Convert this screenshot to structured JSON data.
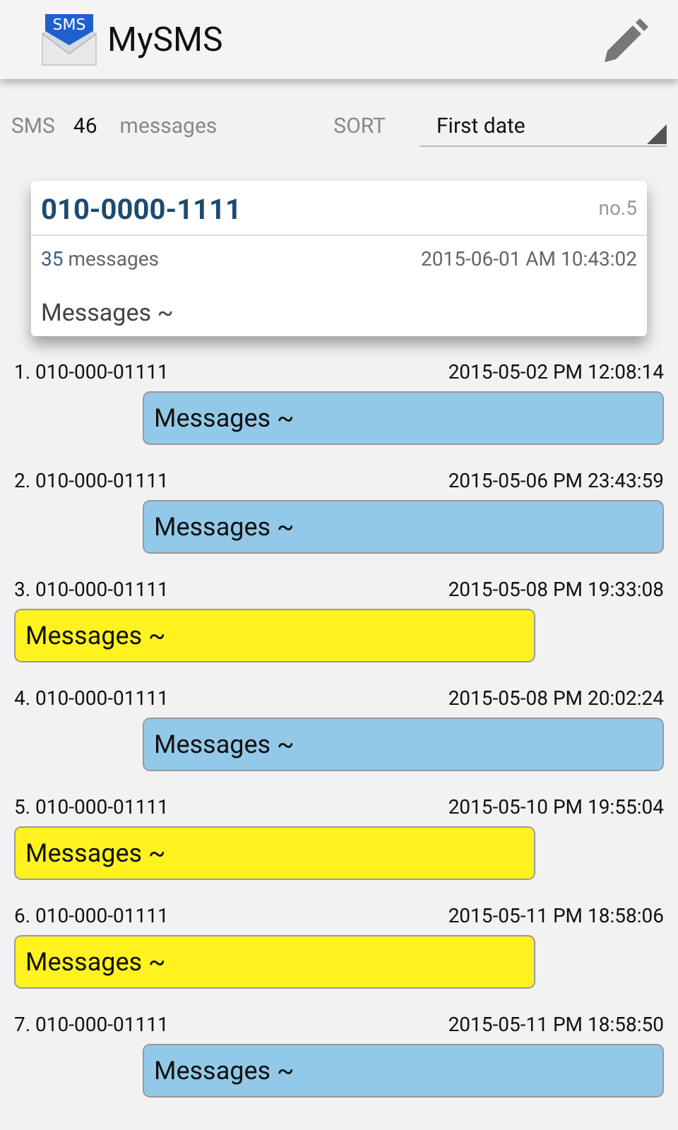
{
  "app_bar": {
    "logo_text": "SMS",
    "title": "MySMS"
  },
  "summary": {
    "label": "SMS",
    "count": "46",
    "unit": "messages",
    "sort_label": "SORT",
    "sort_value": "First date"
  },
  "contact_card": {
    "number": "010-0000-1111",
    "index": "no.5",
    "message_count": "35",
    "message_unit": "messages",
    "date": "2015-06-01 AM 10:43:02",
    "preview": "Messages ~"
  },
  "messages": [
    {
      "title": "1. 010-000-01111",
      "date": "2015-05-02 PM 12:08:14",
      "text": "Messages ~",
      "kind": "incoming"
    },
    {
      "title": "2. 010-000-01111",
      "date": "2015-05-06 PM 23:43:59",
      "text": "Messages ~",
      "kind": "incoming"
    },
    {
      "title": "3. 010-000-01111",
      "date": "2015-05-08 PM 19:33:08",
      "text": "Messages ~",
      "kind": "outgoing"
    },
    {
      "title": "4. 010-000-01111",
      "date": "2015-05-08 PM 20:02:24",
      "text": "Messages ~",
      "kind": "incoming"
    },
    {
      "title": "5. 010-000-01111",
      "date": "2015-05-10 PM 19:55:04",
      "text": "Messages ~",
      "kind": "outgoing"
    },
    {
      "title": "6. 010-000-01111",
      "date": "2015-05-11 PM 18:58:06",
      "text": "Messages ~",
      "kind": "outgoing"
    },
    {
      "title": "7. 010-000-01111",
      "date": "2015-05-11 PM 18:58:50",
      "text": "Messages ~",
      "kind": "incoming"
    }
  ]
}
